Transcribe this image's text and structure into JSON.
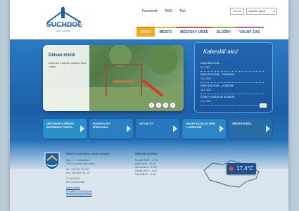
{
  "header": {
    "logo_name": "SUCHDOL",
    "logo_sub": "nad Lužnicí",
    "top_links": [
      "Facebook",
      "RSS",
      "Tisk"
    ],
    "search_label": "Hledat",
    "language_label": "Vyberte jazyk"
  },
  "nav": {
    "items": [
      "ÚVOD",
      "MĚSTO",
      "MĚSTSKÝ ÚŘAD",
      "SLUŽBY",
      "VOLNÝ ČAS"
    ]
  },
  "slider": {
    "title": "Dětské hřiště",
    "text": "Dokončení a doplnění dětského hřiště v parku",
    "dots": [
      "1",
      "2",
      "3",
      "4"
    ]
  },
  "calendar": {
    "title": "Kalendář akcí",
    "events": [
      {
        "name": "KINO SUCHDOL",
        "date": "8.3. 2012"
      },
      {
        "name": "KINO SUCHDOL – POHÁDKY",
        "date": "10.3. 2012"
      },
      {
        "name": "KINO SUCHDOL – KOMEDIE",
        "date": "15.3. 2012"
      },
      {
        "name": "ČESKÝ DIVADELNÍ SOUBOR",
        "date": "17.3. 2012"
      }
    ],
    "more_label": "více"
  },
  "tiles": [
    {
      "label": "OBČANSKÉ A ÚŘEDNÍ INFORMACE PORTÁL",
      "color": "#2b8fc9"
    },
    {
      "label": "SUCHDOLSKÝ ZPRAVODAJ",
      "color": "#2a7fc2"
    },
    {
      "label": "AKTUALITY",
      "color": "#2778bd"
    },
    {
      "label": "ONLINE KATALOG KNIH V KNIHOVNĚ",
      "color": "#2a86c6"
    },
    {
      "label": "ÚŘEDNÍ DESKA",
      "color": "#276ea8"
    }
  ],
  "footer": {
    "title": "MĚSTO SUCHDOL NAD LUŽNICÍ",
    "address": [
      "Nám. T. G. Masaryka 1",
      "378 06 Suchdol nad Lužnicí"
    ],
    "phones": [
      "Tel: +420 384 781 301",
      "Fax: +420 384 781 317"
    ],
    "ids": [
      "IČ: 00247651",
      "DIČ: CZ00247651"
    ],
    "links": [
      "Mapa stránek",
      "Prohlášení o přístupnosti",
      "Technická podpora webu"
    ],
    "hours_title": "ÚŘEDNÍ HODINY",
    "hours": [
      "Pondělí 08:00 – 17:00",
      "Úterý 08:00 – 11:00",
      "Středa 08:00 – 17:00",
      "Čtvrtek 08:00 – 11:00",
      "Pátek 08:00 – 11:00"
    ]
  },
  "weather": {
    "temperature": "17,4°C"
  },
  "colors": {
    "accent": "#f2a91f",
    "primary": "#1c5fa8"
  }
}
